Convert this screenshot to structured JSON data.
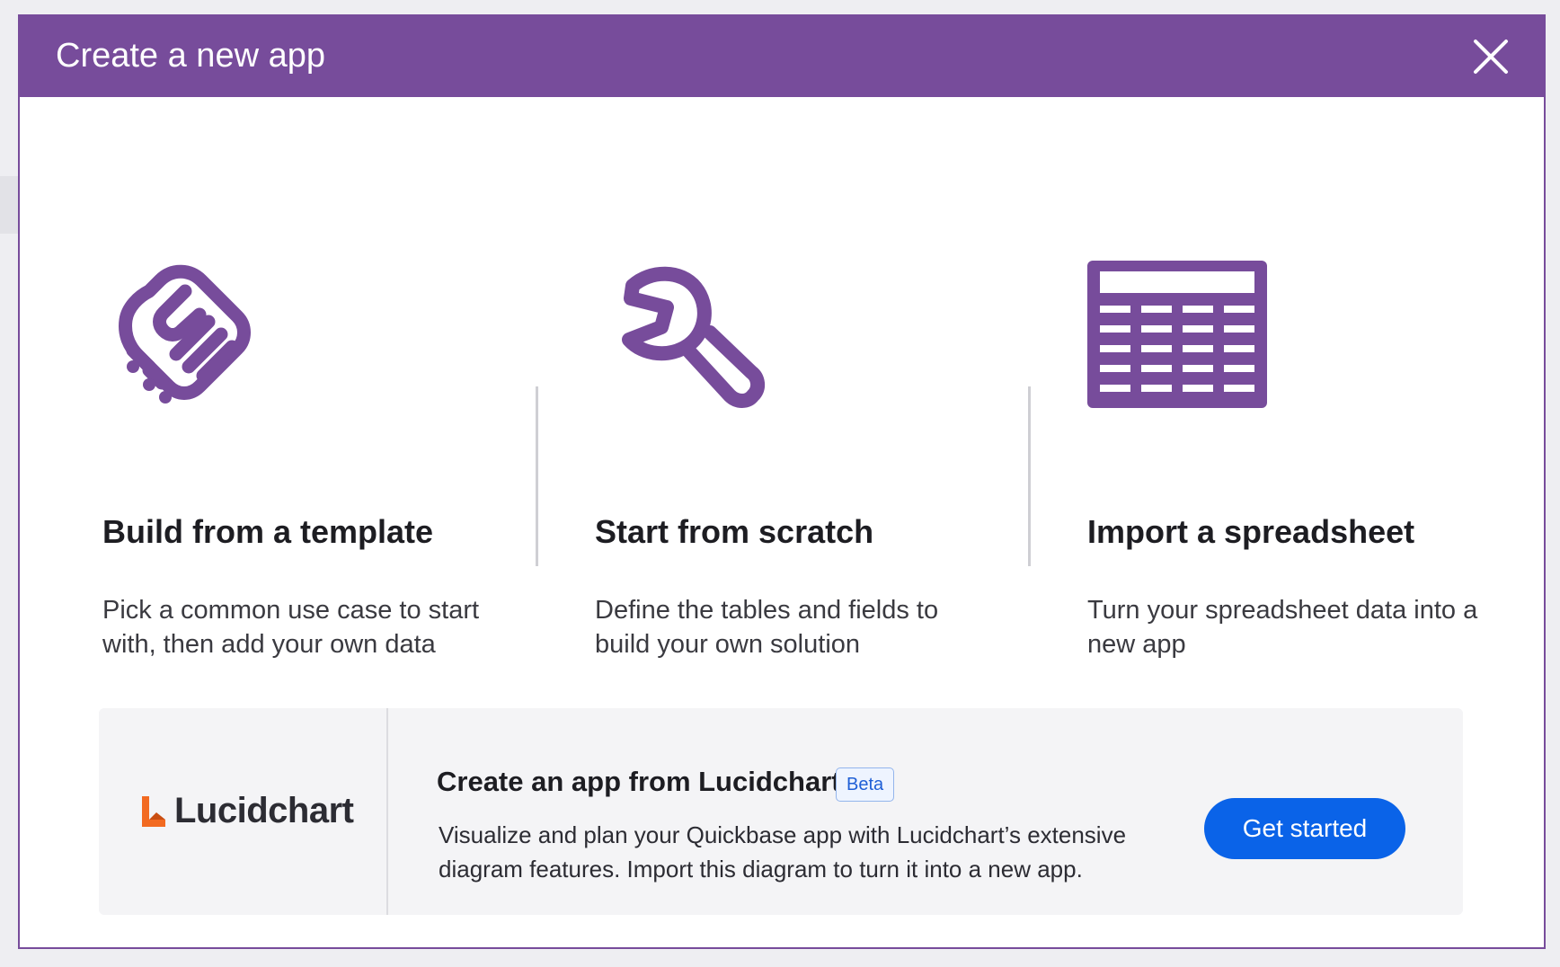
{
  "modal": {
    "title": "Create a new app",
    "close_icon": "close-icon"
  },
  "options": [
    {
      "icon": "handshake-icon",
      "title": "Build from a template",
      "description": "Pick a common use case to start with, then add your own data"
    },
    {
      "icon": "wrench-icon",
      "title": "Start from scratch",
      "description": "Define the tables and fields to build your own solution"
    },
    {
      "icon": "spreadsheet-icon",
      "title": "Import a spreadsheet",
      "description": "Turn your spreadsheet data into a new app"
    }
  ],
  "lucidchart": {
    "logo_text": "Lucidchart",
    "title": "Create an app from Lucidchart",
    "badge": "Beta",
    "description": "Visualize and plan your Quickbase app with Lucidchart’s extensive diagram features. Import this diagram to turn it into a new app.",
    "button_label": "Get started"
  },
  "colors": {
    "brand_purple": "#774c9b",
    "primary_blue": "#0a63e8",
    "lucid_orange": "#f26a21"
  }
}
